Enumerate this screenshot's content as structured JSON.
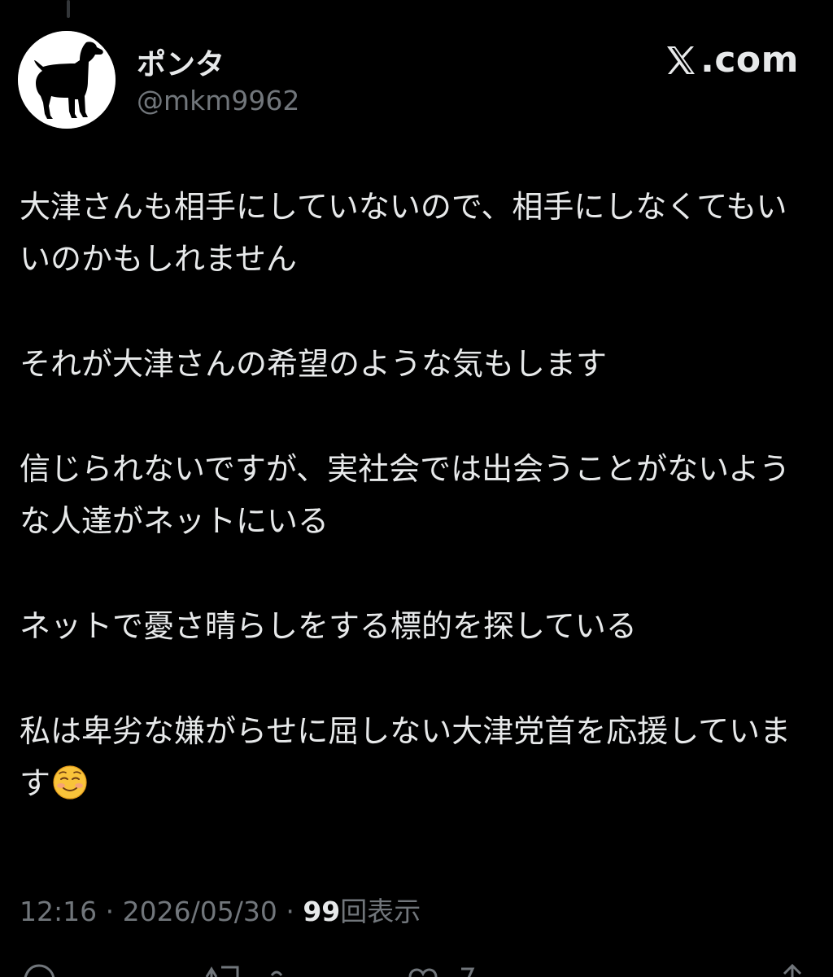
{
  "brand": {
    "text": ".com",
    "icon": "x-logo-icon"
  },
  "author": {
    "display_name": "ポンタ",
    "handle": "@mkm9962",
    "avatar": "dog-silhouette-avatar"
  },
  "post": {
    "paragraphs": [
      "大津さんも相手にしていないので、相手にしなくてもいいのかもしれません",
      "それが大津さんの希望のような気もします",
      "信じられないですが、実社会では出会うことがないような人達がネットにいる",
      "ネットで憂さ晴らしをする標的を探している",
      "私は卑劣な嫌がらせに屈しない大津党首を応援しています"
    ],
    "trailing_emoji": "☺️"
  },
  "meta": {
    "time": "12:16",
    "separator": "·",
    "date": "2026/05/30",
    "views_count": "99",
    "views_label": "回表示"
  },
  "colors": {
    "background": "#000000",
    "text_primary": "#e7e9ea",
    "text_secondary": "#71767b"
  }
}
